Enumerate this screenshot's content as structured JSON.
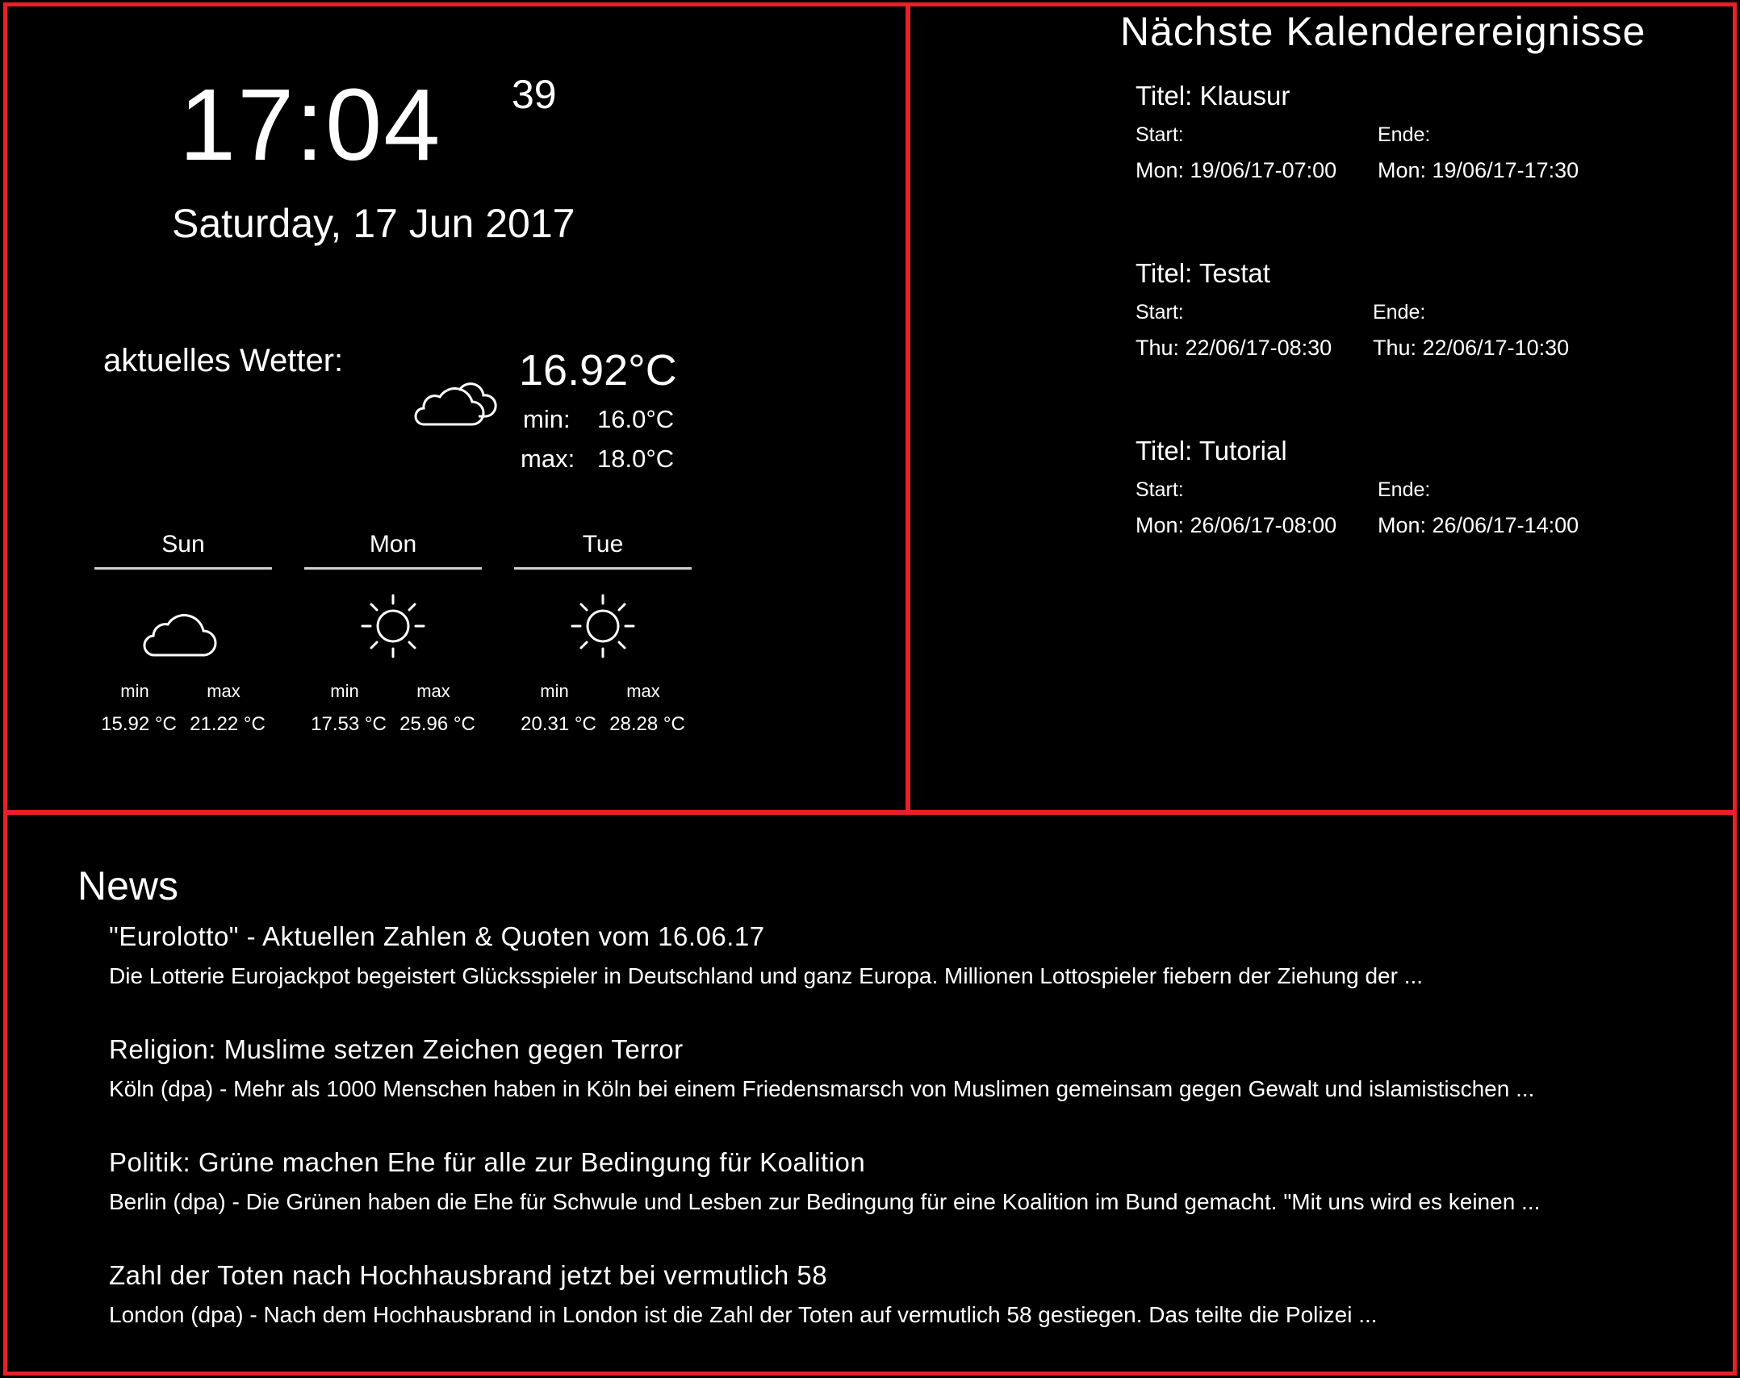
{
  "clock": {
    "time": "17:04",
    "seconds": "39",
    "date": "Saturday, 17 Jun 2017"
  },
  "weather": {
    "label": "aktuelles Wetter:",
    "icon": "cloudy-icon",
    "temp": "16.92°C",
    "min_label": "min:",
    "min_value": "16.0°C",
    "max_label": "max:",
    "max_value": "18.0°C",
    "forecast": [
      {
        "day": "Sun",
        "icon": "cloud-icon",
        "min_label": "min",
        "max_label": "max",
        "min": "15.92 °C",
        "max": "21.22 °C"
      },
      {
        "day": "Mon",
        "icon": "sun-icon",
        "min_label": "min",
        "max_label": "max",
        "min": "17.53 °C",
        "max": "25.96 °C"
      },
      {
        "day": "Tue",
        "icon": "sun-icon",
        "min_label": "min",
        "max_label": "max",
        "min": "20.31 °C",
        "max": "28.28 °C"
      }
    ]
  },
  "calendar": {
    "heading": "Nächste Kalenderereignisse",
    "events": [
      {
        "title": "Titel: Klausur",
        "start_label": "Start:",
        "end_label": "Ende:",
        "start": "Mon: 19/06/17-07:00",
        "end": "Mon: 19/06/17-17:30"
      },
      {
        "title": "Titel: Testat",
        "start_label": "Start:",
        "end_label": "Ende:",
        "start": "Thu: 22/06/17-08:30",
        "end": "Thu: 22/06/17-10:30"
      },
      {
        "title": "Titel: Tutorial",
        "start_label": "Start:",
        "end_label": "Ende:",
        "start": "Mon: 26/06/17-08:00",
        "end": "Mon: 26/06/17-14:00"
      }
    ]
  },
  "news": {
    "heading": "News",
    "items": [
      {
        "title": "\"Eurolotto\" - Aktuellen Zahlen & Quoten vom 16.06.17",
        "body": "Die Lotterie Eurojackpot begeistert Glücksspieler in Deutschland und ganz Europa. Millionen Lottospieler fiebern der Ziehung der  ..."
      },
      {
        "title": "Religion: Muslime setzen Zeichen gegen Terror",
        "body": "Köln (dpa) - Mehr als 1000 Menschen haben in Köln bei einem Friedensmarsch von Muslimen gemeinsam gegen Gewalt und islamistischen ..."
      },
      {
        "title": "Politik: Grüne machen Ehe für alle zur Bedingung für Koalition",
        "body": "Berlin (dpa) - Die Grünen haben die Ehe für Schwule und Lesben zur Bedingung für eine Koalition im Bund gemacht. \"Mit uns wird es keinen ..."
      },
      {
        "title": "Zahl der Toten nach Hochhausbrand jetzt bei vermutlich 58",
        "body": "London (dpa) - Nach dem Hochhausbrand in London ist die Zahl der Toten auf vermutlich 58 gestiegen. Das teilte die Polizei ..."
      }
    ]
  },
  "colors": {
    "background": "#000000",
    "border": "#e8202a",
    "text": "#ffffff"
  }
}
